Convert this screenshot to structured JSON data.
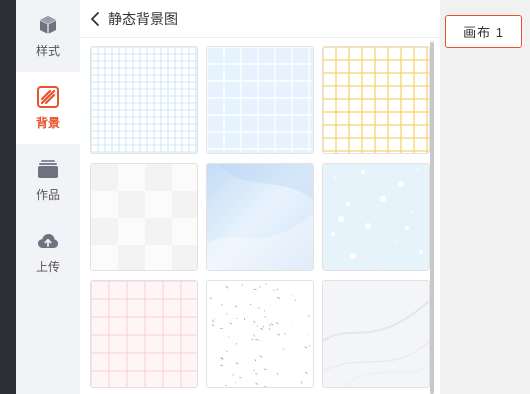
{
  "sidebar": {
    "items": [
      {
        "key": "style",
        "label": "样式",
        "icon": "cube-icon",
        "active": false
      },
      {
        "key": "background",
        "label": "背景",
        "icon": "background-icon",
        "active": true
      },
      {
        "key": "works",
        "label": "作品",
        "icon": "folder-stack-icon",
        "active": false
      },
      {
        "key": "upload",
        "label": "上传",
        "icon": "cloud-upload-icon",
        "active": false
      }
    ]
  },
  "panel": {
    "title": "静态背景图",
    "back_icon": "chevron-left-icon",
    "thumbnails": [
      {
        "pattern": "fine-blue-grid",
        "color": "#bfe0f4"
      },
      {
        "pattern": "light-blue-grid",
        "color": "#d8ecfb"
      },
      {
        "pattern": "yellow-grid",
        "color": "#f3d46f"
      },
      {
        "pattern": "white-checker",
        "color": "#f7f7f7"
      },
      {
        "pattern": "blue-watercolor",
        "color": "#cfe3f8"
      },
      {
        "pattern": "blue-dots",
        "color": "#e4f2fb"
      },
      {
        "pattern": "pink-grid",
        "color": "#f6cfd4"
      },
      {
        "pattern": "speckled-paper",
        "color": "#999999"
      },
      {
        "pattern": "marble-white",
        "color": "#f4f5f8"
      }
    ]
  },
  "canvas_button": {
    "label": "画布 1"
  },
  "colors": {
    "accent": "#e8532e",
    "sidebar_bg": "#f2f3f6"
  }
}
